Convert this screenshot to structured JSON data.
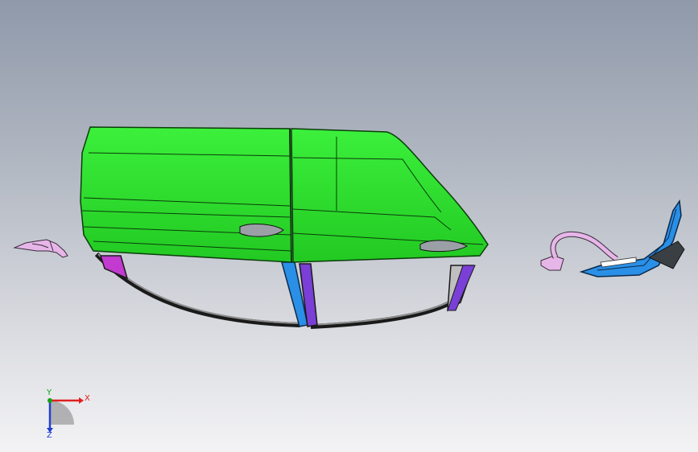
{
  "viewport": {
    "background_top": "#8f99aa",
    "background_bottom": "#f3f3f5"
  },
  "colors": {
    "door_green": "#2fe02f",
    "door_green_dark": "#1fa81f",
    "edge": "#0b3d0b",
    "pillar_blue": "#2a8fe6",
    "pillar_purple": "#7a3fd6",
    "bracket_pink": "#e7b6e9",
    "magenta": "#c23ad0",
    "axis_x": "#e02020",
    "axis_y": "#16a016",
    "axis_z": "#2040d0"
  },
  "triad": {
    "x_label": "X",
    "y_label": "Y",
    "z_label": "Z"
  }
}
